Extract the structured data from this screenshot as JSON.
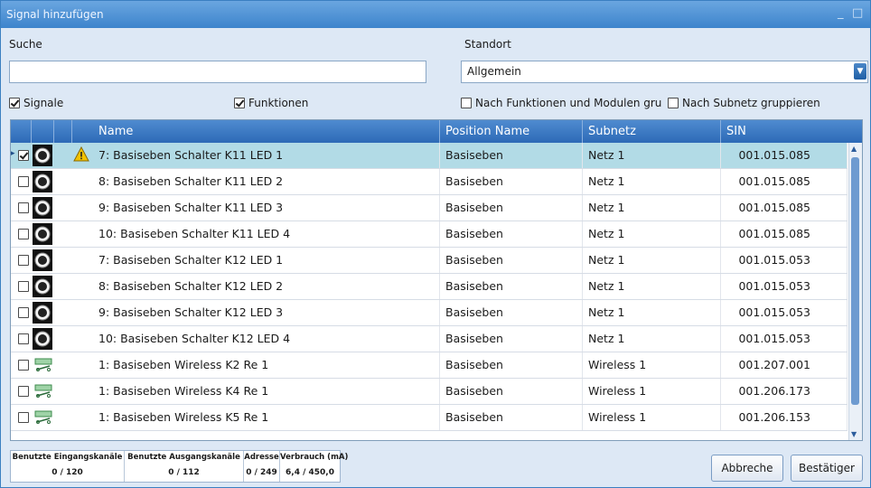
{
  "window": {
    "title": "Signal hinzufügen",
    "controls": {
      "minimize": "_",
      "maximize": "□"
    }
  },
  "search": {
    "label": "Suche",
    "value": "",
    "placeholder": ""
  },
  "location": {
    "label": "Standort",
    "value": "Allgemein"
  },
  "filters": {
    "signale": {
      "label": "Signale",
      "checked": true
    },
    "funktionen": {
      "label": "Funktionen",
      "checked": true
    },
    "group_functions": {
      "label": "Nach Funktionen und Modulen grupp",
      "checked": false
    },
    "group_subnet": {
      "label": "Nach Subnetz gruppieren",
      "checked": false
    }
  },
  "table": {
    "columns": [
      "Name",
      "Position Name",
      "Subnetz",
      "SIN"
    ],
    "rows": [
      {
        "icon": "signal-circle-icon",
        "warning": true,
        "checked": true,
        "selected": true,
        "name": "7: Basiseben Schalter K11 LED 1",
        "position": "Basiseben",
        "subnet": "Netz 1",
        "sin": "001.015.085"
      },
      {
        "icon": "signal-circle-icon",
        "warning": false,
        "checked": false,
        "selected": false,
        "name": "8: Basiseben Schalter K11 LED 2",
        "position": "Basiseben",
        "subnet": "Netz 1",
        "sin": "001.015.085"
      },
      {
        "icon": "signal-circle-icon",
        "warning": false,
        "checked": false,
        "selected": false,
        "name": "9: Basiseben Schalter K11 LED 3",
        "position": "Basiseben",
        "subnet": "Netz 1",
        "sin": "001.015.085"
      },
      {
        "icon": "signal-circle-icon",
        "warning": false,
        "checked": false,
        "selected": false,
        "name": "10: Basiseben Schalter K11 LED 4",
        "position": "Basiseben",
        "subnet": "Netz 1",
        "sin": "001.015.085"
      },
      {
        "icon": "signal-circle-icon",
        "warning": false,
        "checked": false,
        "selected": false,
        "name": "7: Basiseben Schalter K12 LED 1",
        "position": "Basiseben",
        "subnet": "Netz 1",
        "sin": "001.015.053"
      },
      {
        "icon": "signal-circle-icon",
        "warning": false,
        "checked": false,
        "selected": false,
        "name": "8: Basiseben Schalter K12 LED 2",
        "position": "Basiseben",
        "subnet": "Netz 1",
        "sin": "001.015.053"
      },
      {
        "icon": "signal-circle-icon",
        "warning": false,
        "checked": false,
        "selected": false,
        "name": "9: Basiseben Schalter K12 LED 3",
        "position": "Basiseben",
        "subnet": "Netz 1",
        "sin": "001.015.053"
      },
      {
        "icon": "signal-circle-icon",
        "warning": false,
        "checked": false,
        "selected": false,
        "name": "10: Basiseben Schalter K12 LED 4",
        "position": "Basiseben",
        "subnet": "Netz 1",
        "sin": "001.015.053"
      },
      {
        "icon": "wireless-relay-icon",
        "warning": false,
        "checked": false,
        "selected": false,
        "name": "1: Basiseben Wireless K2 Re 1",
        "position": "Basiseben",
        "subnet": "Wireless 1",
        "sin": "001.207.001"
      },
      {
        "icon": "wireless-relay-icon",
        "warning": false,
        "checked": false,
        "selected": false,
        "name": "1: Basiseben Wireless K4 Re 1",
        "position": "Basiseben",
        "subnet": "Wireless 1",
        "sin": "001.206.173"
      },
      {
        "icon": "wireless-relay-icon",
        "warning": false,
        "checked": false,
        "selected": false,
        "name": "1: Basiseben Wireless K5 Re 1",
        "position": "Basiseben",
        "subnet": "Wireless 1",
        "sin": "001.206.153"
      }
    ]
  },
  "status": [
    {
      "label": "Benutzte Eingangskanäle",
      "value": "0 / 120"
    },
    {
      "label": "Benutzte Ausgangskanäle",
      "value": "0 / 112"
    },
    {
      "label": "Adresse",
      "value": "0 / 249"
    },
    {
      "label": "Verbrauch (mA)",
      "value": "6,4 / 450,0"
    }
  ],
  "buttons": {
    "cancel": "Abbreche",
    "confirm": "Bestätiger"
  },
  "colors": {
    "header": "#2d6ab7",
    "selected_row": "#b2dbe6",
    "warning": "#f2c200"
  }
}
